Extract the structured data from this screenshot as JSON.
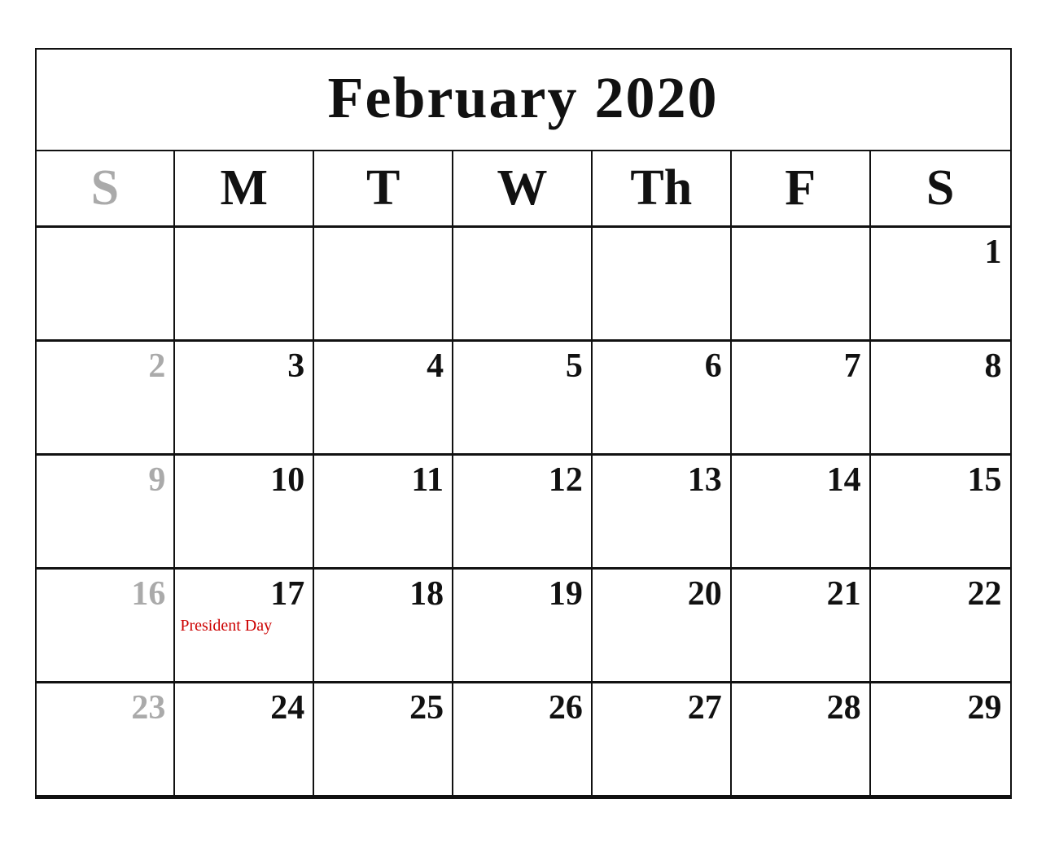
{
  "header": {
    "title": "February 2020"
  },
  "day_headers": [
    {
      "label": "S",
      "key": "sunday",
      "class": "sunday"
    },
    {
      "label": "M",
      "key": "monday",
      "class": ""
    },
    {
      "label": "T",
      "key": "tuesday",
      "class": ""
    },
    {
      "label": "W",
      "key": "wednesday",
      "class": ""
    },
    {
      "label": "Th",
      "key": "thursday",
      "class": ""
    },
    {
      "label": "F",
      "key": "friday",
      "class": ""
    },
    {
      "label": "S",
      "key": "saturday",
      "class": ""
    }
  ],
  "weeks": [
    {
      "days": [
        {
          "number": "",
          "sunday": true,
          "holiday": ""
        },
        {
          "number": "",
          "sunday": false,
          "holiday": ""
        },
        {
          "number": "",
          "sunday": false,
          "holiday": ""
        },
        {
          "number": "",
          "sunday": false,
          "holiday": ""
        },
        {
          "number": "",
          "sunday": false,
          "holiday": ""
        },
        {
          "number": "",
          "sunday": false,
          "holiday": ""
        },
        {
          "number": "1",
          "sunday": false,
          "holiday": ""
        }
      ]
    },
    {
      "days": [
        {
          "number": "2",
          "sunday": true,
          "holiday": ""
        },
        {
          "number": "3",
          "sunday": false,
          "holiday": ""
        },
        {
          "number": "4",
          "sunday": false,
          "holiday": ""
        },
        {
          "number": "5",
          "sunday": false,
          "holiday": ""
        },
        {
          "number": "6",
          "sunday": false,
          "holiday": ""
        },
        {
          "number": "7",
          "sunday": false,
          "holiday": ""
        },
        {
          "number": "8",
          "sunday": false,
          "holiday": ""
        }
      ]
    },
    {
      "days": [
        {
          "number": "9",
          "sunday": true,
          "holiday": ""
        },
        {
          "number": "10",
          "sunday": false,
          "holiday": ""
        },
        {
          "number": "11",
          "sunday": false,
          "holiday": ""
        },
        {
          "number": "12",
          "sunday": false,
          "holiday": ""
        },
        {
          "number": "13",
          "sunday": false,
          "holiday": ""
        },
        {
          "number": "14",
          "sunday": false,
          "holiday": ""
        },
        {
          "number": "15",
          "sunday": false,
          "holiday": ""
        }
      ]
    },
    {
      "days": [
        {
          "number": "16",
          "sunday": true,
          "holiday": ""
        },
        {
          "number": "17",
          "sunday": false,
          "holiday": "President Day"
        },
        {
          "number": "18",
          "sunday": false,
          "holiday": ""
        },
        {
          "number": "19",
          "sunday": false,
          "holiday": ""
        },
        {
          "number": "20",
          "sunday": false,
          "holiday": ""
        },
        {
          "number": "21",
          "sunday": false,
          "holiday": ""
        },
        {
          "number": "22",
          "sunday": false,
          "holiday": ""
        }
      ]
    },
    {
      "days": [
        {
          "number": "23",
          "sunday": true,
          "holiday": ""
        },
        {
          "number": "24",
          "sunday": false,
          "holiday": ""
        },
        {
          "number": "25",
          "sunday": false,
          "holiday": ""
        },
        {
          "number": "26",
          "sunday": false,
          "holiday": ""
        },
        {
          "number": "27",
          "sunday": false,
          "holiday": ""
        },
        {
          "number": "28",
          "sunday": false,
          "holiday": ""
        },
        {
          "number": "29",
          "sunday": false,
          "holiday": ""
        }
      ]
    }
  ]
}
